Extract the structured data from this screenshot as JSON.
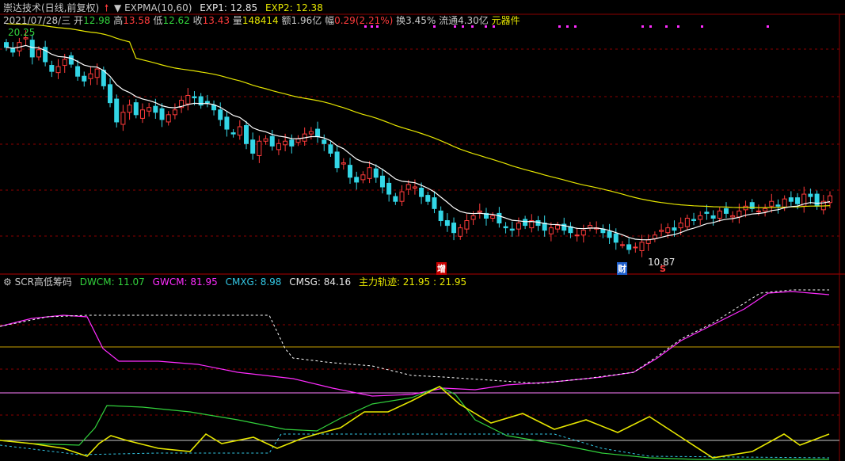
{
  "header": {
    "stock_name": "崇达技术(日线,前复权)",
    "indicator": "EXPMA(10,60)",
    "exp1": "EXP1: 12.85",
    "exp2": "EXP2: 12.38",
    "date": "2021/07/28/三",
    "open_label": "开",
    "open": "12.98",
    "high_label": "高",
    "high": "13.58",
    "low_label": "低",
    "low": "12.62",
    "close_label": "收",
    "close": "13.43",
    "vol_label": "量",
    "vol": "148414",
    "amount": "额1.96亿",
    "change_label": "幅",
    "change": "0.29(2.21%)",
    "turnover": "换3.45%",
    "float": "流通4.30亿",
    "sector": "元器件"
  },
  "price_panel": {
    "max_label": "20.25",
    "min_label": "10.87",
    "marker_zeng": "增",
    "marker_cai": "财",
    "marker_s": "S"
  },
  "scr_panel": {
    "title": "SCR高低筹码",
    "dwcm": "DWCM: 11.07",
    "gwcm": "GWCM: 81.95",
    "cmxg": "CMXG: 8.98",
    "cmsg": "CMSG: 84.16",
    "zlgj": "主力轨迹: 21.95 : 21.95"
  },
  "colors": {
    "up": "#ff3b3b",
    "down": "#33d6e6",
    "exp1": "#ffffff",
    "exp2": "#e6e600",
    "gwcm": "#ff2cff",
    "dwcm": "#32d23c",
    "zlgj": "#e6e600",
    "grid": "#8b0000"
  },
  "chart_data": {
    "type": "candlestick",
    "title": "崇达技术(日线,前复权)",
    "price_range": [
      10.87,
      20.25
    ],
    "close_series": [
      19.6,
      19.4,
      19.8,
      20.0,
      19.2,
      19.5,
      19.0,
      18.6,
      18.8,
      19.1,
      18.9,
      18.4,
      18.2,
      18.5,
      18.7,
      18.0,
      17.3,
      16.5,
      16.9,
      17.2,
      16.8,
      17.0,
      17.1,
      16.9,
      16.6,
      16.8,
      17.0,
      17.4,
      17.6,
      17.5,
      17.2,
      17.3,
      17.0,
      16.6,
      16.2,
      16.0,
      16.3,
      15.6,
      15.2,
      15.7,
      15.8,
      15.5,
      15.6,
      15.7,
      15.5,
      15.8,
      16.0,
      16.1,
      15.9,
      15.6,
      15.2,
      14.6,
      14.8,
      14.2,
      14.0,
      14.3,
      14.6,
      14.2,
      13.8,
      13.5,
      13.2,
      13.6,
      13.9,
      13.8,
      13.4,
      13.2,
      12.9,
      12.4,
      12.2,
      11.9,
      12.1,
      12.4,
      12.6,
      12.8,
      12.5,
      12.6,
      12.3,
      12.1,
      12.0,
      12.3,
      12.2,
      12.4,
      12.2,
      12.0,
      12.1,
      12.2,
      12.0,
      11.9,
      11.8,
      12.0,
      12.2,
      12.1,
      11.9,
      11.7,
      11.5,
      11.4,
      11.2,
      11.3,
      11.5,
      11.6,
      11.8,
      12.0,
      12.1,
      12.0,
      12.3,
      12.5,
      12.4,
      12.6,
      12.7,
      12.5,
      12.8,
      12.7,
      12.6,
      12.8,
      13.0,
      12.9,
      12.8,
      12.9,
      13.2,
      13.0,
      13.3,
      13.2,
      13.1,
      13.5,
      13.4,
      13.0,
      13.2,
      13.43
    ]
  }
}
